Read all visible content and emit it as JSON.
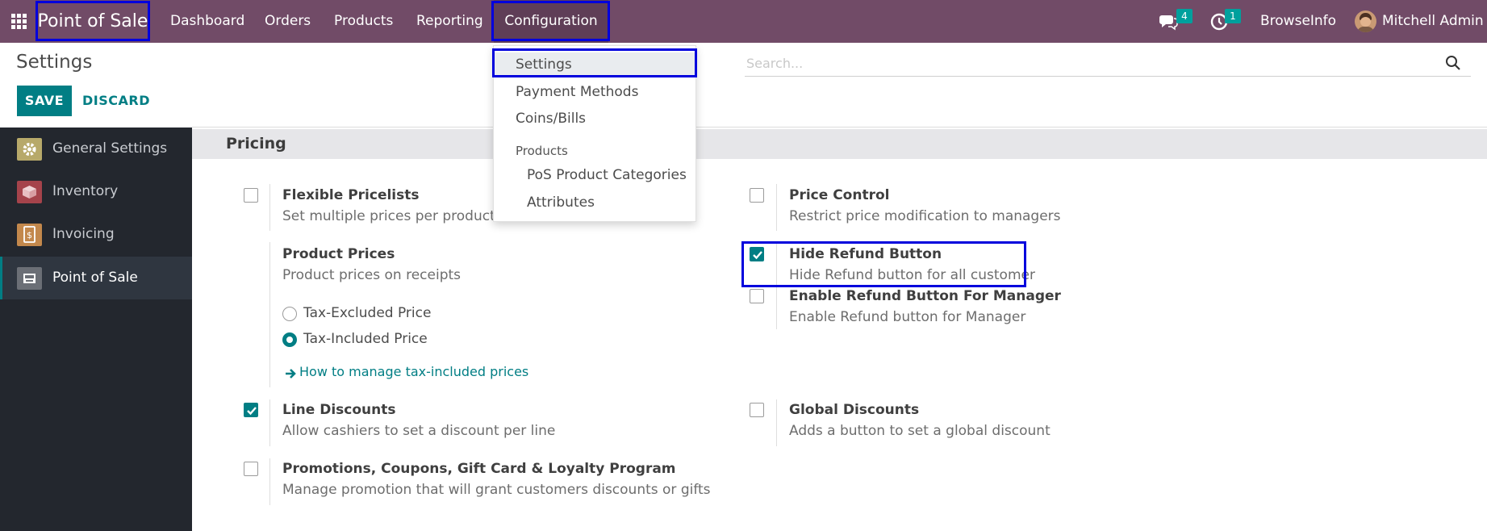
{
  "navbar": {
    "brand": "Point of Sale",
    "menus": [
      "Dashboard",
      "Orders",
      "Products",
      "Reporting",
      "Configuration"
    ],
    "messages_count": "4",
    "activities_count": "1",
    "company": "BrowseInfo",
    "user": "Mitchell Admin"
  },
  "control_panel": {
    "title": "Settings",
    "save_label": "SAVE",
    "discard_label": "DISCARD",
    "search_placeholder": "Search..."
  },
  "sidebar": {
    "items": [
      {
        "label": "General Settings",
        "icon": "gear-icon"
      },
      {
        "label": "Inventory",
        "icon": "box-icon"
      },
      {
        "label": "Invoicing",
        "icon": "invoice-icon"
      },
      {
        "label": "Point of Sale",
        "icon": "store-icon",
        "active": true
      }
    ]
  },
  "dropdown": {
    "items": [
      "Settings",
      "Payment Methods",
      "Coins/Bills"
    ],
    "group_header": "Products",
    "group_items": [
      "PoS Product Categories",
      "Attributes"
    ]
  },
  "section": {
    "title": "Pricing"
  },
  "settings": {
    "flexible_pricelists": {
      "title": "Flexible Pricelists",
      "desc": "Set multiple prices per product, a",
      "checked": false
    },
    "price_control": {
      "title": "Price Control",
      "desc": "Restrict price modification to managers",
      "checked": false
    },
    "product_prices": {
      "title": "Product Prices",
      "desc": "Product prices on receipts"
    },
    "tax_excluded": "Tax-Excluded Price",
    "tax_included": "Tax-Included Price",
    "tax_link": "How to manage tax-included prices",
    "hide_refund": {
      "title": "Hide Refund Button",
      "desc": "Hide Refund button for all customer",
      "checked": true
    },
    "enable_refund_manager": {
      "title": "Enable Refund Button For Manager",
      "desc": "Enable Refund button for Manager",
      "checked": false
    },
    "line_discounts": {
      "title": "Line Discounts",
      "desc": "Allow cashiers to set a discount per line",
      "checked": true
    },
    "global_discounts": {
      "title": "Global Discounts",
      "desc": "Adds a button to set a global discount",
      "checked": false
    },
    "promotions": {
      "title": "Promotions, Coupons, Gift Card & Loyalty Program",
      "desc": "Manage promotion that will grant customers discounts or gifts",
      "checked": false
    }
  },
  "colors": {
    "navbar": "#714B67",
    "accent": "#017E84",
    "sidebar": "#23272e",
    "highlight": "#0000dd"
  }
}
